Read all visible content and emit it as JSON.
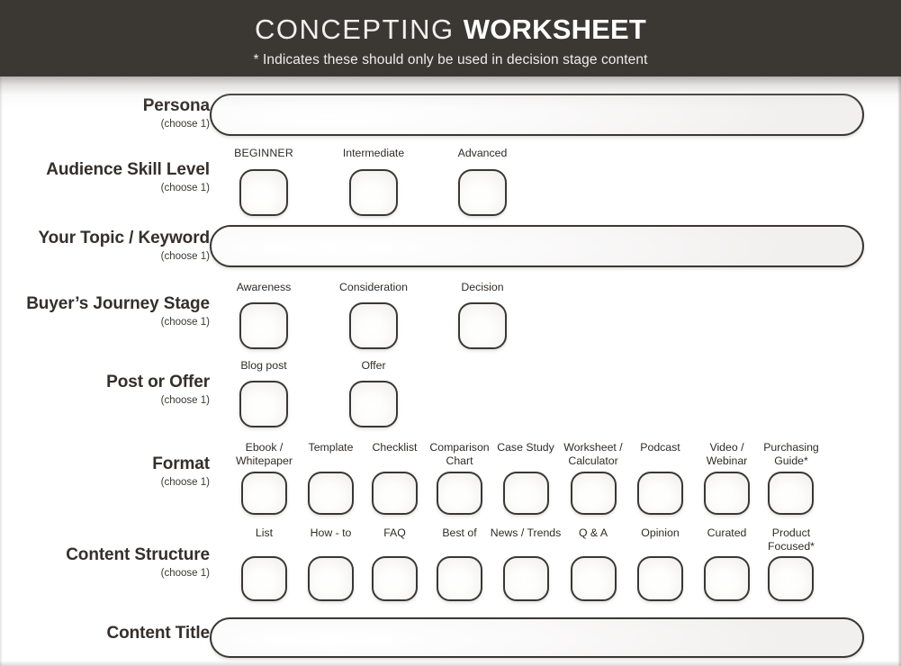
{
  "header": {
    "title_thin": "CONCEPTING",
    "title_bold": "WORKSHEET",
    "subtitle": "* Indicates these should only be used in decision stage content",
    "bg_color": "#3b3834"
  },
  "choose_one": "(choose 1)",
  "sections": {
    "persona": {
      "label": "Persona",
      "sub": "(choose 1)",
      "value": "",
      "placeholder": ""
    },
    "audience_skill_level": {
      "label": "Audience Skill Level",
      "sub": "(choose 1)",
      "options": [
        {
          "label": "BEGINNER",
          "checked": false
        },
        {
          "label": "Intermediate",
          "checked": false
        },
        {
          "label": "Advanced",
          "checked": false
        }
      ]
    },
    "topic_keyword": {
      "label": "Your Topic / Keyword",
      "sub": "(choose 1)",
      "value": "",
      "placeholder": ""
    },
    "buyers_journey_stage": {
      "label": "Buyer’s Journey Stage",
      "sub": "(choose 1)",
      "options": [
        {
          "label": "Awareness",
          "checked": false
        },
        {
          "label": "Consideration",
          "checked": false
        },
        {
          "label": "Decision",
          "checked": false
        }
      ]
    },
    "post_or_offer": {
      "label": "Post or Offer",
      "sub": "(choose 1)",
      "options": [
        {
          "label": "Blog post",
          "checked": false
        },
        {
          "label": "Offer",
          "checked": false
        }
      ]
    },
    "format": {
      "label": "Format",
      "sub": "(choose 1)",
      "options": [
        {
          "label": "Ebook /\nWhitepaper",
          "checked": false
        },
        {
          "label": "Template",
          "checked": false
        },
        {
          "label": "Checklist",
          "checked": false
        },
        {
          "label": "Comparison\nChart",
          "checked": false
        },
        {
          "label": "Case Study",
          "checked": false
        },
        {
          "label": "Worksheet /\nCalculator",
          "checked": false
        },
        {
          "label": "Podcast",
          "checked": false
        },
        {
          "label": "Video /\nWebinar",
          "checked": false
        },
        {
          "label": "Purchasing\nGuide*",
          "checked": false
        }
      ]
    },
    "content_structure": {
      "label": "Content Structure",
      "sub": "(choose 1)",
      "options": [
        {
          "label": "List",
          "checked": false
        },
        {
          "label": "How - to",
          "checked": false
        },
        {
          "label": "FAQ",
          "checked": false
        },
        {
          "label": "Best of",
          "checked": false
        },
        {
          "label": "News / Trends",
          "checked": false
        },
        {
          "label": "Q & A",
          "checked": false
        },
        {
          "label": "Opinion",
          "checked": false
        },
        {
          "label": "Curated",
          "checked": false
        },
        {
          "label": "Product\nFocused*",
          "checked": false
        }
      ]
    },
    "content_title": {
      "label": "Content Title",
      "sub": "",
      "value": "",
      "placeholder": ""
    }
  },
  "colors": {
    "ink": "#3a3734",
    "header_bg": "#3b3834",
    "page_bg": "#ffffff"
  }
}
